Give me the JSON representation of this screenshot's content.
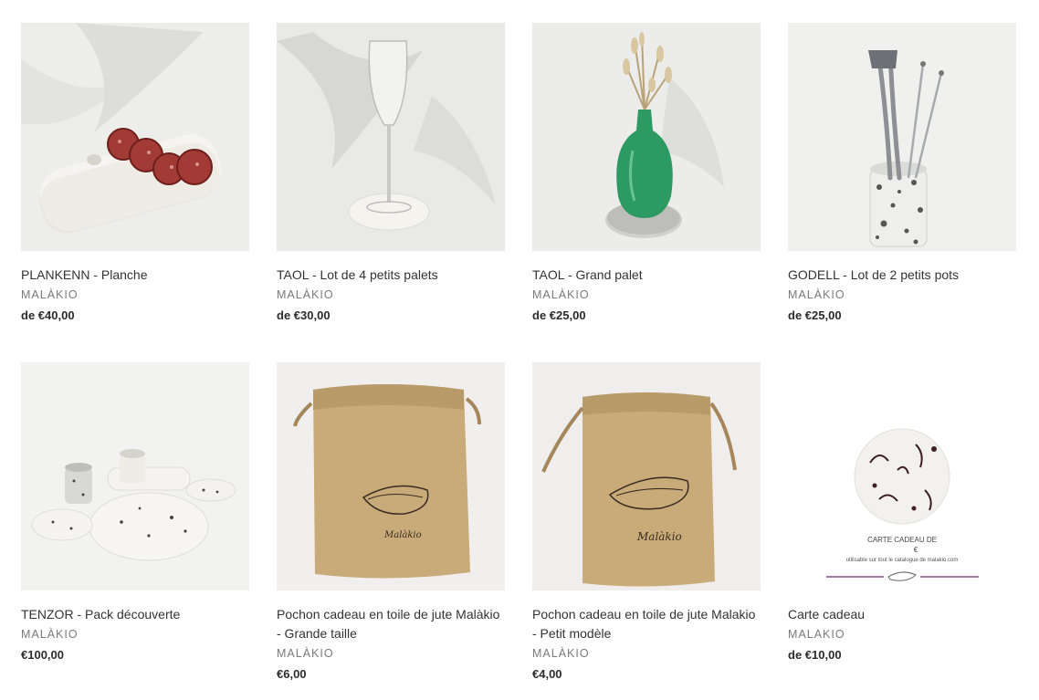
{
  "products": [
    {
      "title": "PLANKENN - Planche",
      "vendor": "MALÀKIO",
      "price": "de €40,00",
      "image_icon": "cheese-board-image"
    },
    {
      "title": "TAOL - Lot de 4 petits palets",
      "vendor": "MALÀKIO",
      "price": "de €30,00",
      "image_icon": "wine-glass-coaster-image"
    },
    {
      "title": "TAOL - Grand palet",
      "vendor": "MALÀKIO",
      "price": "de €25,00",
      "image_icon": "vase-on-coaster-image"
    },
    {
      "title": "GODELL - Lot de 2 petits pots",
      "vendor": "MALÀKIO",
      "price": "de €25,00",
      "image_icon": "utensil-pot-image"
    },
    {
      "title": "TENZOR - Pack découverte",
      "vendor": "MALÀKIO",
      "price": "€100,00",
      "image_icon": "discovery-pack-image"
    },
    {
      "title": "Pochon cadeau en toile de jute Malàkio - Grande taille",
      "vendor": "MALÀKIO",
      "price": "€6,00",
      "image_icon": "jute-bag-large-image"
    },
    {
      "title": "Pochon cadeau en toile de jute Malakio - Petit modèle",
      "vendor": "MALÀKIO",
      "price": "€4,00",
      "image_icon": "jute-bag-small-image"
    },
    {
      "title": "Carte cadeau",
      "vendor": "MALAKIO",
      "price": "de €10,00",
      "image_icon": "gift-card-image"
    }
  ],
  "gift_card": {
    "heading": "CARTE CADEAU DE",
    "currency": "€",
    "subtext": "utilisable sur tout le catalogue de malakio.com"
  },
  "jute_bag_signature": "Malàkio",
  "colors": {
    "accent_line": "#a0799a",
    "vase_green": "#2e9a63",
    "jute": "#c9ab7a"
  }
}
